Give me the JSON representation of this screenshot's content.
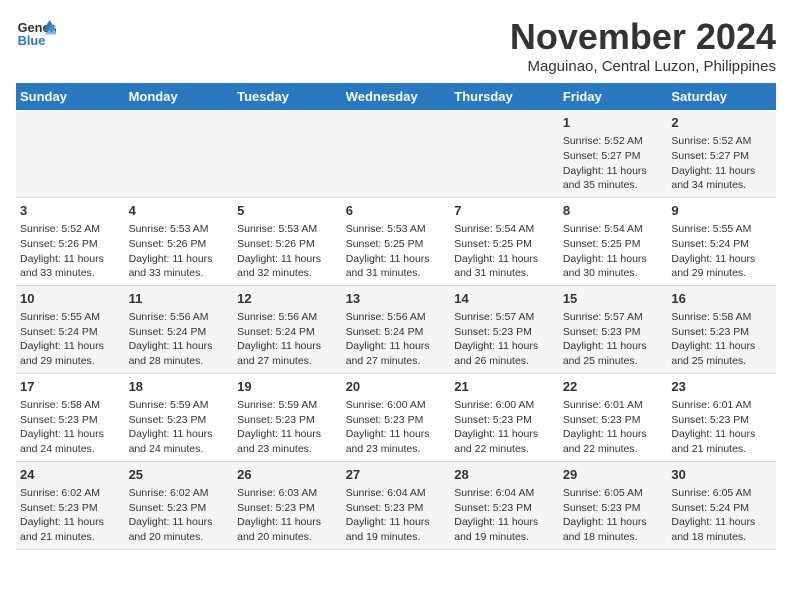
{
  "logo": {
    "line1": "General",
    "line2": "Blue"
  },
  "title": "November 2024",
  "subtitle": "Maguinao, Central Luzon, Philippines",
  "weekdays": [
    "Sunday",
    "Monday",
    "Tuesday",
    "Wednesday",
    "Thursday",
    "Friday",
    "Saturday"
  ],
  "weeks": [
    [
      {
        "day": "",
        "info": ""
      },
      {
        "day": "",
        "info": ""
      },
      {
        "day": "",
        "info": ""
      },
      {
        "day": "",
        "info": ""
      },
      {
        "day": "",
        "info": ""
      },
      {
        "day": "1",
        "info": "Sunrise: 5:52 AM\nSunset: 5:27 PM\nDaylight: 11 hours and 35 minutes."
      },
      {
        "day": "2",
        "info": "Sunrise: 5:52 AM\nSunset: 5:27 PM\nDaylight: 11 hours and 34 minutes."
      }
    ],
    [
      {
        "day": "3",
        "info": "Sunrise: 5:52 AM\nSunset: 5:26 PM\nDaylight: 11 hours and 33 minutes."
      },
      {
        "day": "4",
        "info": "Sunrise: 5:53 AM\nSunset: 5:26 PM\nDaylight: 11 hours and 33 minutes."
      },
      {
        "day": "5",
        "info": "Sunrise: 5:53 AM\nSunset: 5:26 PM\nDaylight: 11 hours and 32 minutes."
      },
      {
        "day": "6",
        "info": "Sunrise: 5:53 AM\nSunset: 5:25 PM\nDaylight: 11 hours and 31 minutes."
      },
      {
        "day": "7",
        "info": "Sunrise: 5:54 AM\nSunset: 5:25 PM\nDaylight: 11 hours and 31 minutes."
      },
      {
        "day": "8",
        "info": "Sunrise: 5:54 AM\nSunset: 5:25 PM\nDaylight: 11 hours and 30 minutes."
      },
      {
        "day": "9",
        "info": "Sunrise: 5:55 AM\nSunset: 5:24 PM\nDaylight: 11 hours and 29 minutes."
      }
    ],
    [
      {
        "day": "10",
        "info": "Sunrise: 5:55 AM\nSunset: 5:24 PM\nDaylight: 11 hours and 29 minutes."
      },
      {
        "day": "11",
        "info": "Sunrise: 5:56 AM\nSunset: 5:24 PM\nDaylight: 11 hours and 28 minutes."
      },
      {
        "day": "12",
        "info": "Sunrise: 5:56 AM\nSunset: 5:24 PM\nDaylight: 11 hours and 27 minutes."
      },
      {
        "day": "13",
        "info": "Sunrise: 5:56 AM\nSunset: 5:24 PM\nDaylight: 11 hours and 27 minutes."
      },
      {
        "day": "14",
        "info": "Sunrise: 5:57 AM\nSunset: 5:23 PM\nDaylight: 11 hours and 26 minutes."
      },
      {
        "day": "15",
        "info": "Sunrise: 5:57 AM\nSunset: 5:23 PM\nDaylight: 11 hours and 25 minutes."
      },
      {
        "day": "16",
        "info": "Sunrise: 5:58 AM\nSunset: 5:23 PM\nDaylight: 11 hours and 25 minutes."
      }
    ],
    [
      {
        "day": "17",
        "info": "Sunrise: 5:58 AM\nSunset: 5:23 PM\nDaylight: 11 hours and 24 minutes."
      },
      {
        "day": "18",
        "info": "Sunrise: 5:59 AM\nSunset: 5:23 PM\nDaylight: 11 hours and 24 minutes."
      },
      {
        "day": "19",
        "info": "Sunrise: 5:59 AM\nSunset: 5:23 PM\nDaylight: 11 hours and 23 minutes."
      },
      {
        "day": "20",
        "info": "Sunrise: 6:00 AM\nSunset: 5:23 PM\nDaylight: 11 hours and 23 minutes."
      },
      {
        "day": "21",
        "info": "Sunrise: 6:00 AM\nSunset: 5:23 PM\nDaylight: 11 hours and 22 minutes."
      },
      {
        "day": "22",
        "info": "Sunrise: 6:01 AM\nSunset: 5:23 PM\nDaylight: 11 hours and 22 minutes."
      },
      {
        "day": "23",
        "info": "Sunrise: 6:01 AM\nSunset: 5:23 PM\nDaylight: 11 hours and 21 minutes."
      }
    ],
    [
      {
        "day": "24",
        "info": "Sunrise: 6:02 AM\nSunset: 5:23 PM\nDaylight: 11 hours and 21 minutes."
      },
      {
        "day": "25",
        "info": "Sunrise: 6:02 AM\nSunset: 5:23 PM\nDaylight: 11 hours and 20 minutes."
      },
      {
        "day": "26",
        "info": "Sunrise: 6:03 AM\nSunset: 5:23 PM\nDaylight: 11 hours and 20 minutes."
      },
      {
        "day": "27",
        "info": "Sunrise: 6:04 AM\nSunset: 5:23 PM\nDaylight: 11 hours and 19 minutes."
      },
      {
        "day": "28",
        "info": "Sunrise: 6:04 AM\nSunset: 5:23 PM\nDaylight: 11 hours and 19 minutes."
      },
      {
        "day": "29",
        "info": "Sunrise: 6:05 AM\nSunset: 5:23 PM\nDaylight: 11 hours and 18 minutes."
      },
      {
        "day": "30",
        "info": "Sunrise: 6:05 AM\nSunset: 5:24 PM\nDaylight: 11 hours and 18 minutes."
      }
    ]
  ]
}
